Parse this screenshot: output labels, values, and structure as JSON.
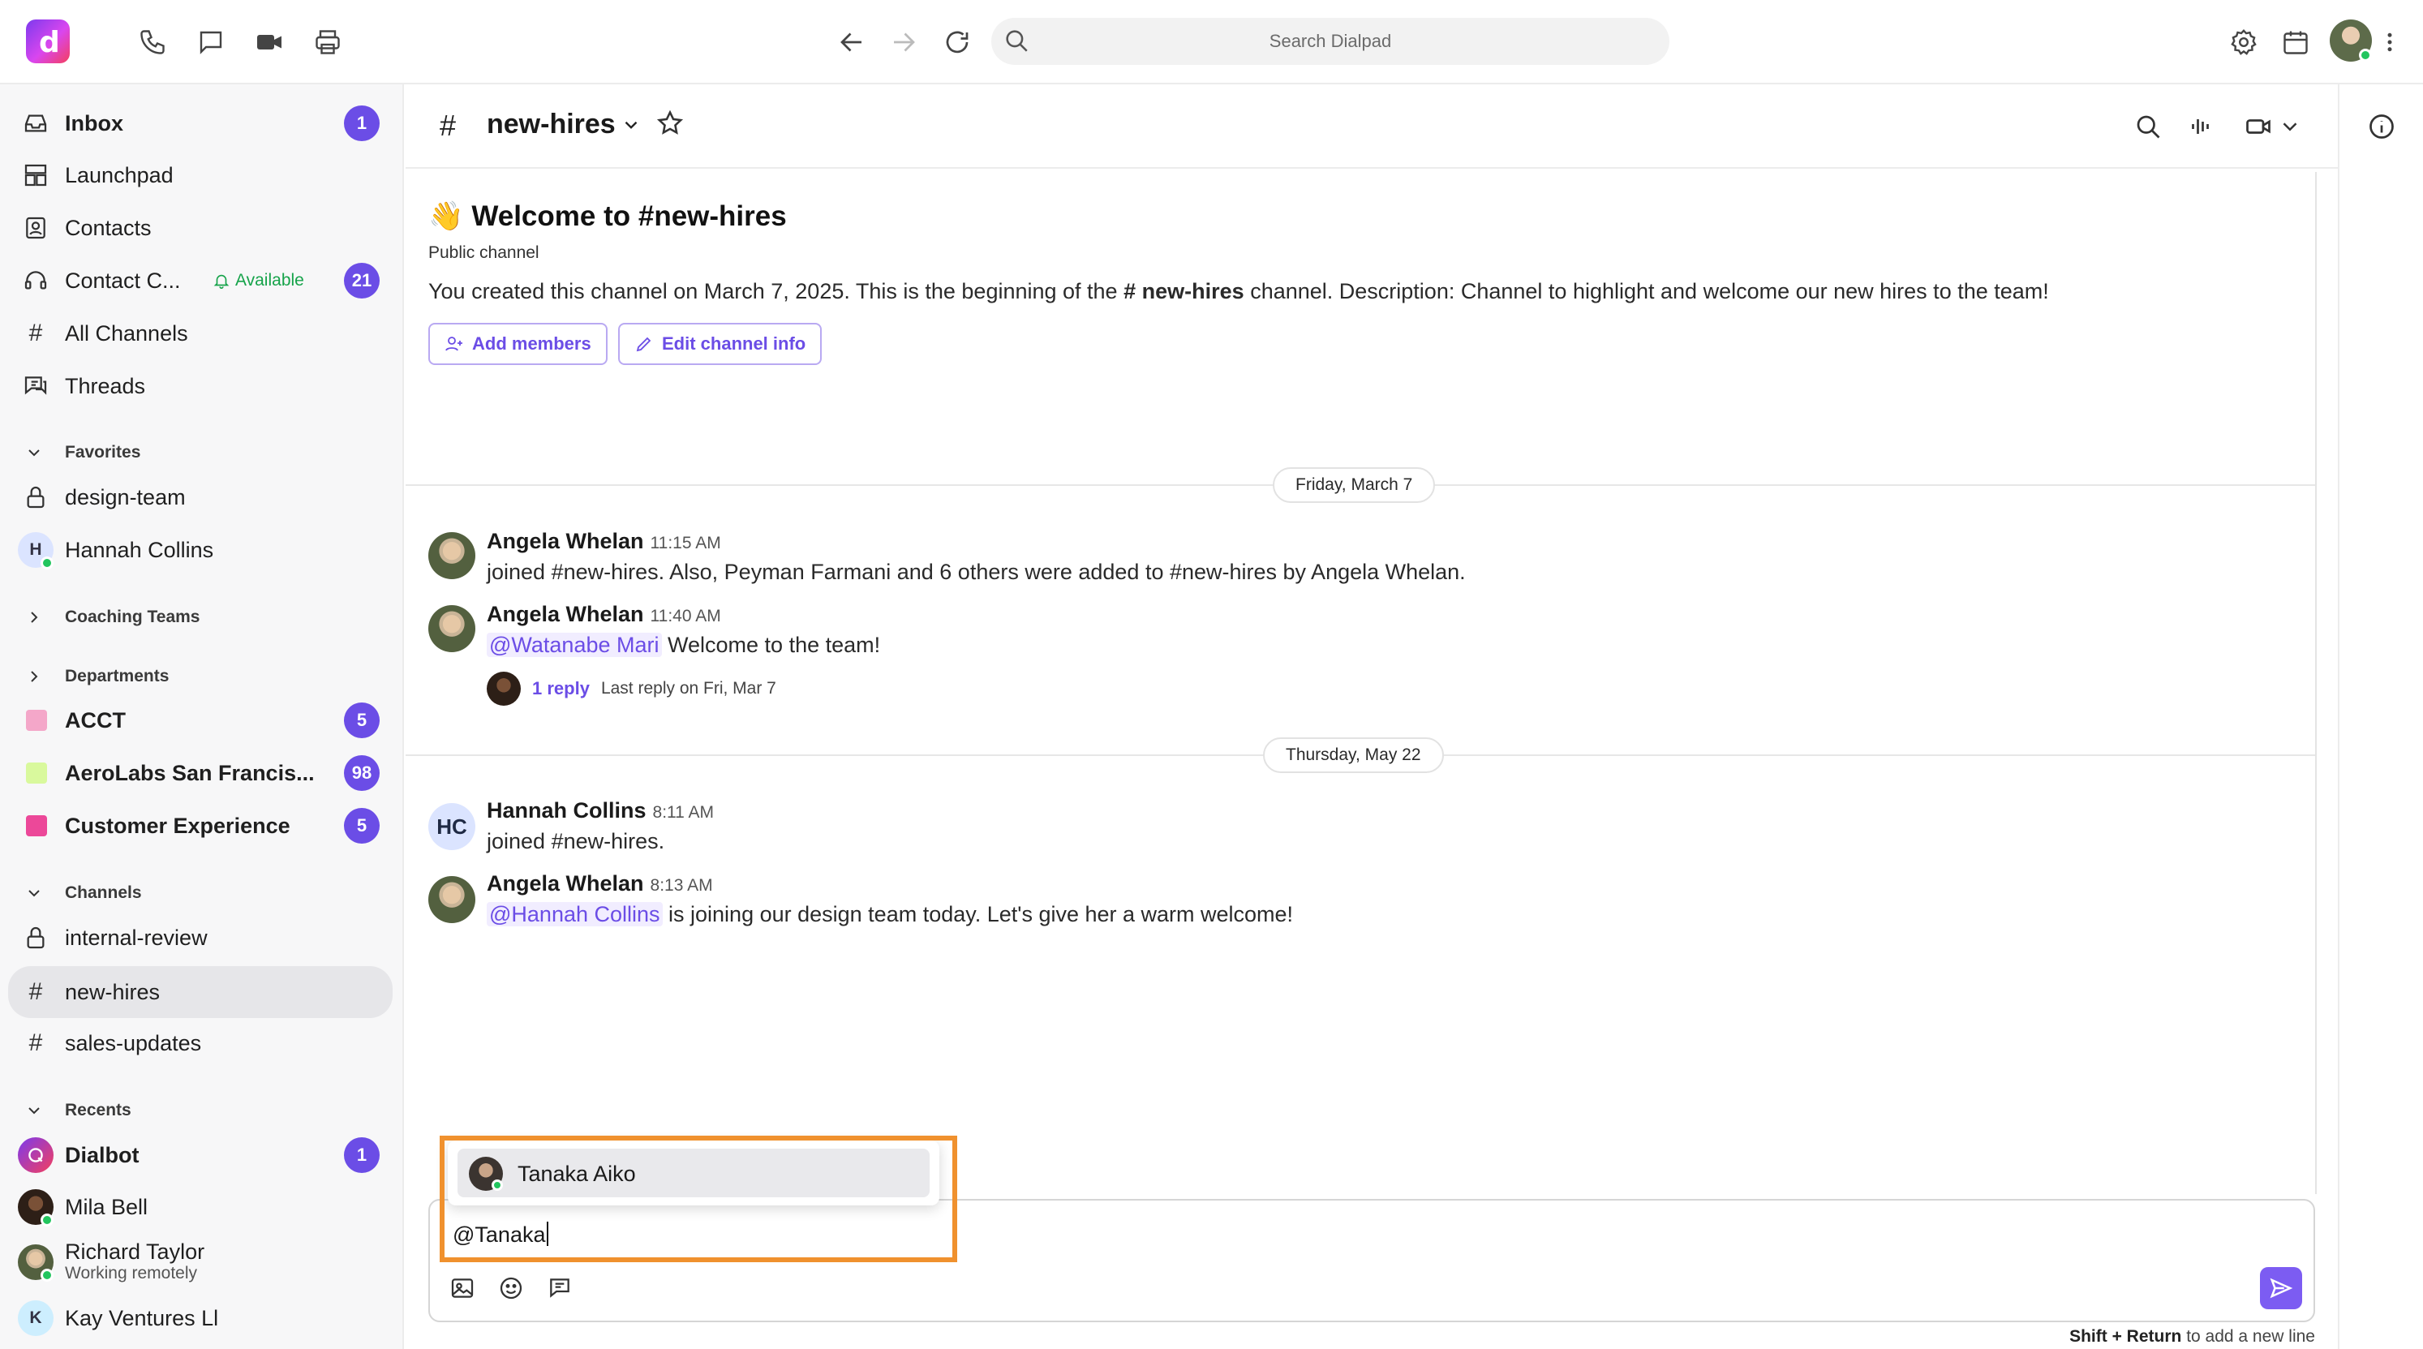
{
  "topbar": {
    "search_placeholder": "Search Dialpad",
    "logo_letter": "d"
  },
  "sidebar": {
    "items": [
      {
        "label": "Inbox",
        "badge": "1",
        "bold": true
      },
      {
        "label": "Launchpad"
      },
      {
        "label": "Contacts"
      },
      {
        "label": "Contact C...",
        "status": "Available",
        "badge": "21"
      },
      {
        "label": "All Channels"
      },
      {
        "label": "Threads"
      }
    ],
    "favorites": {
      "header": "Favorites",
      "items": [
        {
          "label": "design-team"
        },
        {
          "label": "Hannah Collins",
          "initial": "H"
        }
      ]
    },
    "coaching_header": "Coaching Teams",
    "departments": {
      "header": "Departments",
      "items": [
        {
          "label": "ACCT",
          "badge": "5",
          "color": "#f4a7c9"
        },
        {
          "label": "AeroLabs San Francis...",
          "badge": "98",
          "color": "#d9f99d"
        },
        {
          "label": "Customer Experience",
          "badge": "5",
          "color": "#ec4899"
        }
      ]
    },
    "channels": {
      "header": "Channels",
      "items": [
        {
          "label": "internal-review"
        },
        {
          "label": "new-hires"
        },
        {
          "label": "sales-updates"
        }
      ]
    },
    "recents": {
      "header": "Recents",
      "items": [
        {
          "label": "Dialbot",
          "badge": "1"
        },
        {
          "label": "Mila Bell"
        },
        {
          "label": "Richard Taylor",
          "sub": "Working remotely"
        },
        {
          "label": "Kay Ventures Ll",
          "initial": "K"
        }
      ]
    }
  },
  "channel": {
    "name": "new-hires",
    "hash": "#",
    "welcome_emoji": "👋",
    "welcome_prefix": "Welcome to",
    "welcome_name": "new-hires",
    "type": "Public channel",
    "desc_before": "You created this channel on March 7, 2025. This is the beginning of the",
    "desc_channel": "new-hires",
    "desc_after": "channel. Description: Channel to highlight and welcome our new hires to the team!",
    "add_members": "Add members",
    "edit_info": "Edit channel info"
  },
  "dates": {
    "first": "Friday, March 7",
    "second": "Thursday, May 22"
  },
  "messages": [
    {
      "author": "Angela Whelan",
      "time": "11:15 AM",
      "text": "joined #new-hires. Also, Peyman Farmani and 6 others were added to #new-hires by Angela Whelan."
    },
    {
      "author": "Angela Whelan",
      "time": "11:40 AM",
      "mention": "@Watanabe Mari",
      "text": "Welcome to the team!",
      "reply_count": "1 reply",
      "reply_meta": "Last reply on Fri, Mar 7"
    },
    {
      "author": "Hannah Collins",
      "time": "8:11 AM",
      "initials": "HC",
      "text": "joined #new-hires."
    },
    {
      "author": "Angela Whelan",
      "time": "8:13 AM",
      "mention": "@Hannah Collins",
      "text": "is joining our design team today. Let's give her a warm welcome!"
    }
  ],
  "composer": {
    "value": "@Tanaka",
    "suggestion": "Tanaka Aiko",
    "hint_keys": "Shift + Return",
    "hint_text": "to add a new line"
  }
}
